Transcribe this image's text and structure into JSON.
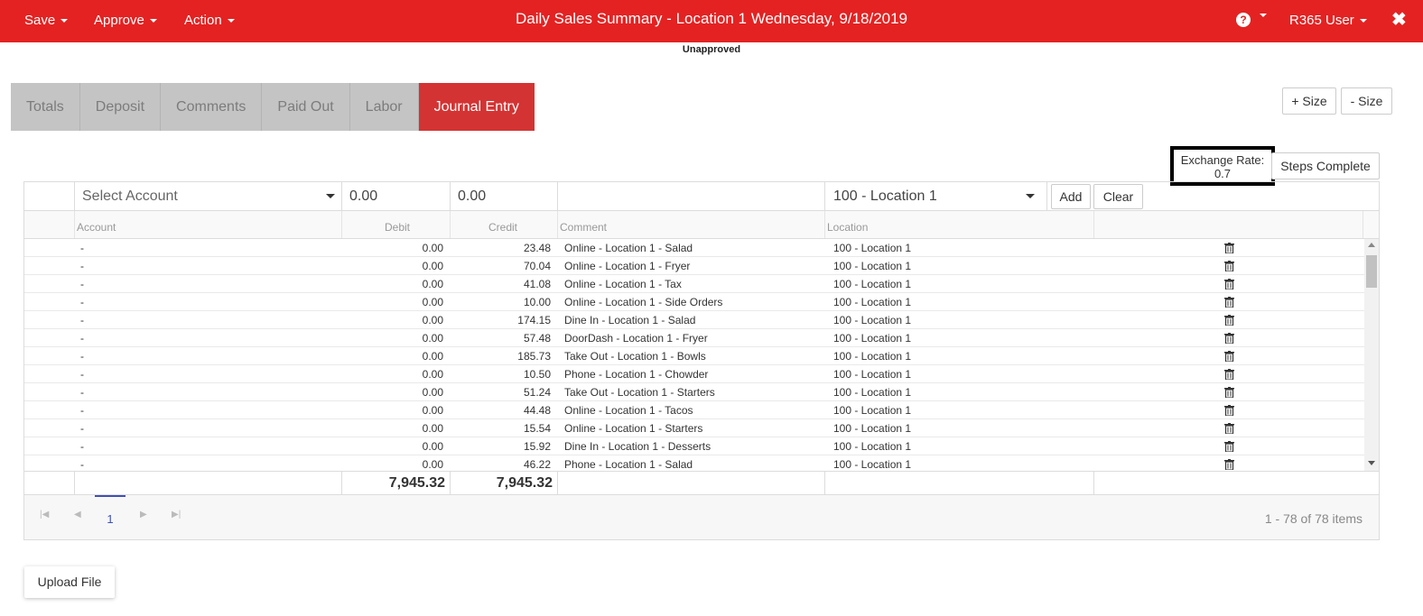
{
  "topbar": {
    "menus": [
      {
        "label": "Save"
      },
      {
        "label": "Approve"
      },
      {
        "label": "Action"
      }
    ],
    "title": "Daily Sales Summary - Location 1 Wednesday, 9/18/2019",
    "help_glyph": "?",
    "user_label": "R365 User",
    "close_glyph": "✖",
    "accent_color": "#e42222"
  },
  "status_label": "Unapproved",
  "tabs": [
    {
      "label": "Totals"
    },
    {
      "label": "Deposit"
    },
    {
      "label": "Comments"
    },
    {
      "label": "Paid Out"
    },
    {
      "label": "Labor"
    },
    {
      "label": "Journal Entry",
      "active": true
    }
  ],
  "size_buttons": {
    "plus": "+ Size",
    "minus": "- Size"
  },
  "exchange": {
    "label": "Exchange Rate:",
    "value": "0.7"
  },
  "steps_complete_label": "Steps Complete",
  "entry": {
    "account_placeholder": "Select Account",
    "debit": "0.00",
    "credit": "0.00",
    "comment": "",
    "location": "100 - Location 1",
    "add_label": "Add",
    "clear_label": "Clear"
  },
  "columns": {
    "account": "Account",
    "debit": "Debit",
    "credit": "Credit",
    "comment": "Comment",
    "location": "Location"
  },
  "rows": [
    {
      "account": "-",
      "debit": "0.00",
      "credit": "23.48",
      "comment": "Online - Location 1 - Salad",
      "location": "100 - Location 1"
    },
    {
      "account": "-",
      "debit": "0.00",
      "credit": "70.04",
      "comment": "Online - Location 1 - Fryer",
      "location": "100 - Location 1"
    },
    {
      "account": "-",
      "debit": "0.00",
      "credit": "41.08",
      "comment": "Online - Location 1 - Tax",
      "location": "100 - Location 1"
    },
    {
      "account": "-",
      "debit": "0.00",
      "credit": "10.00",
      "comment": "Online - Location 1 - Side Orders",
      "location": "100 - Location 1"
    },
    {
      "account": "-",
      "debit": "0.00",
      "credit": "174.15",
      "comment": "Dine In - Location 1 - Salad",
      "location": "100 - Location 1"
    },
    {
      "account": "-",
      "debit": "0.00",
      "credit": "57.48",
      "comment": "DoorDash - Location 1 - Fryer",
      "location": "100 - Location 1"
    },
    {
      "account": "-",
      "debit": "0.00",
      "credit": "185.73",
      "comment": "Take Out - Location 1 - Bowls",
      "location": "100 - Location 1"
    },
    {
      "account": "-",
      "debit": "0.00",
      "credit": "10.50",
      "comment": "Phone - Location 1 - Chowder",
      "location": "100 - Location 1"
    },
    {
      "account": "-",
      "debit": "0.00",
      "credit": "51.24",
      "comment": "Take Out - Location 1 - Starters",
      "location": "100 - Location 1"
    },
    {
      "account": "-",
      "debit": "0.00",
      "credit": "44.48",
      "comment": "Online - Location 1 - Tacos",
      "location": "100 - Location 1"
    },
    {
      "account": "-",
      "debit": "0.00",
      "credit": "15.54",
      "comment": "Online - Location 1 - Starters",
      "location": "100 - Location 1"
    },
    {
      "account": "-",
      "debit": "0.00",
      "credit": "15.92",
      "comment": "Dine In - Location 1 - Desserts",
      "location": "100 - Location 1"
    },
    {
      "account": "-",
      "debit": "0.00",
      "credit": "46.22",
      "comment": "Phone - Location 1 - Salad",
      "location": "100 - Location 1"
    }
  ],
  "totals": {
    "debit": "7,945.32",
    "credit": "7,945.32"
  },
  "pager": {
    "current_page": "1",
    "info": "1 - 78 of 78 items"
  },
  "upload_label": "Upload File"
}
